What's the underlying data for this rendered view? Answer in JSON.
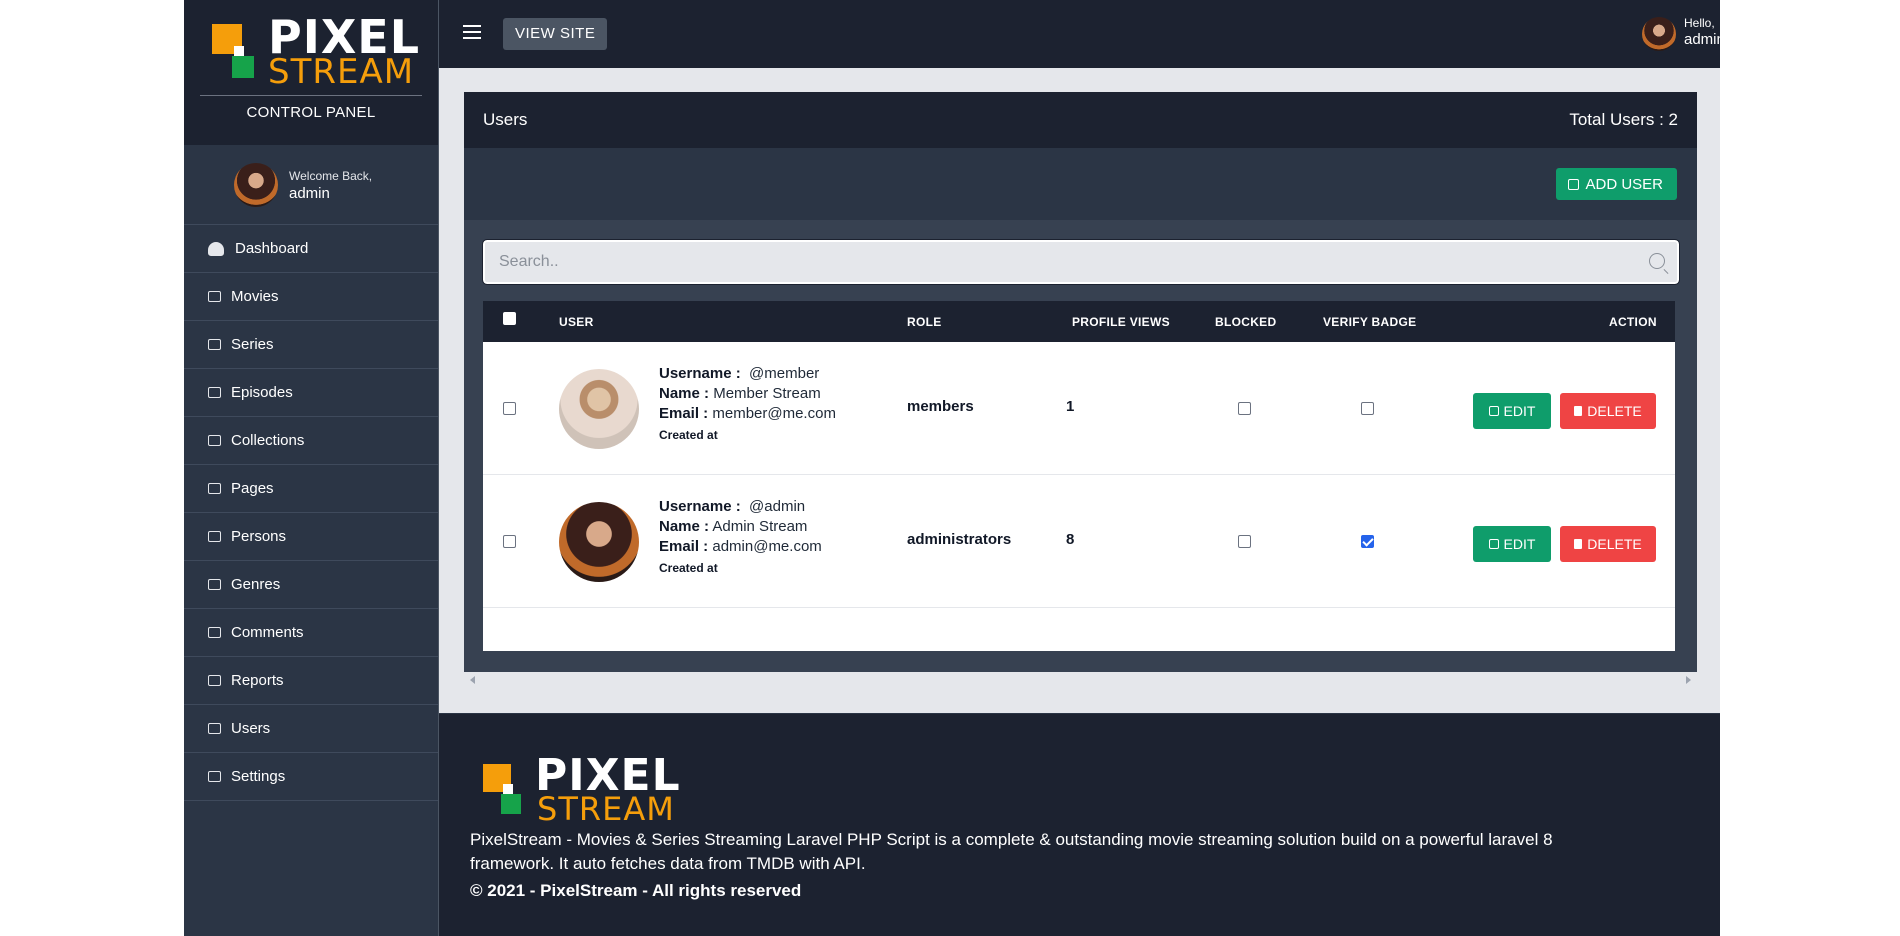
{
  "brand": {
    "logo_top": "PIXEL",
    "logo_bottom": "STREAM",
    "subtitle": "CONTROL PANEL"
  },
  "welcome": {
    "greeting": "Welcome Back,",
    "name": "admin"
  },
  "sidebar": {
    "items": [
      {
        "label": "Dashboard",
        "icon": "dashboard-icon"
      },
      {
        "label": "Movies",
        "icon": "film-icon"
      },
      {
        "label": "Series",
        "icon": "film-icon"
      },
      {
        "label": "Episodes",
        "icon": "film-icon"
      },
      {
        "label": "Collections",
        "icon": "folder-icon"
      },
      {
        "label": "Pages",
        "icon": "pages-icon"
      },
      {
        "label": "Persons",
        "icon": "persons-icon"
      },
      {
        "label": "Genres",
        "icon": "genres-icon"
      },
      {
        "label": "Comments",
        "icon": "comment-icon"
      },
      {
        "label": "Reports",
        "icon": "alert-icon"
      },
      {
        "label": "Users",
        "icon": "users-icon"
      },
      {
        "label": "Settings",
        "icon": "gear-icon"
      }
    ]
  },
  "topbar": {
    "view_site": "VIEW SITE",
    "hello": "Hello,",
    "user": "admin"
  },
  "card": {
    "title": "Users",
    "total": "Total Users : 2",
    "add_user": "ADD USER",
    "search_placeholder": "Search.."
  },
  "table": {
    "headers": {
      "user": "USER",
      "role": "ROLE",
      "profile_views": "PROFILE VIEWS",
      "blocked": "BLOCKED",
      "verify_badge": "VERIFY BADGE",
      "action": "ACTION"
    },
    "labels": {
      "username": "Username :",
      "name": "Name :",
      "email": "Email :",
      "created": "Created at",
      "edit": "EDIT",
      "delete": "DELETE"
    },
    "rows": [
      {
        "username": "@member",
        "name": "Member Stream",
        "email": "member@me.com",
        "role": "members",
        "views": "1",
        "blocked": false,
        "verified": false
      },
      {
        "username": "@admin",
        "name": "Admin Stream",
        "email": "admin@me.com",
        "role": "administrators",
        "views": "8",
        "blocked": false,
        "verified": true
      }
    ]
  },
  "footer": {
    "description": "PixelStream - Movies & Series Streaming Laravel PHP Script is a complete & outstanding movie streaming solution build on a powerful laravel 8 framework. It auto fetches data from TMDB with API.",
    "copyright": "© 2021 - PixelStream - All rights reserved"
  },
  "colors": {
    "accent_green": "#0f9d6b",
    "danger_red": "#ef4444",
    "brand_orange": "#f59e0b",
    "dark_bg": "#1c2230"
  }
}
